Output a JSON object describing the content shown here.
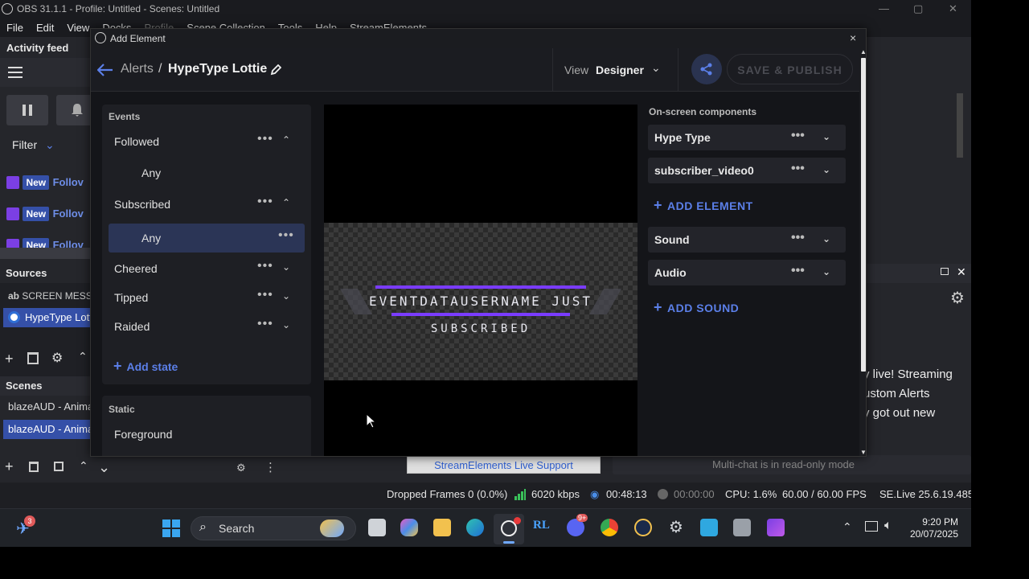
{
  "window": {
    "title": "OBS 31.1.1 - Profile: Untitled - Scenes: Untitled",
    "minimize": "—",
    "maximize": "▢",
    "close": "✕"
  },
  "menu": [
    "File",
    "Edit",
    "View",
    "Docks",
    "Profile",
    "Scene Collection",
    "Tools",
    "Help",
    "StreamElements"
  ],
  "left_dock": {
    "activity_title": "Activity feed",
    "filter_label": "Filter",
    "feed_items": [
      {
        "badge": "New",
        "text": "Follov"
      },
      {
        "badge": "New",
        "text": "Follov"
      },
      {
        "badge": "New",
        "text": "Follov"
      }
    ],
    "sources_title": "Sources",
    "sources": [
      {
        "prefix": "ab",
        "name": "SCREEN MESS"
      },
      {
        "prefix": "",
        "name": "HypeType Lott"
      }
    ],
    "scenes_title": "Scenes",
    "scenes": [
      "blazeAUD - Anima",
      "blazeAUD - Anima"
    ]
  },
  "right_dock": {
    "chat_lines": [
      "y live! Streaming",
      "ustom Alerts",
      "y got out new"
    ],
    "readonly": "Multi-chat is in read-only mode"
  },
  "bottom": {
    "support_button": "StreamElements Live Support"
  },
  "status": {
    "dropped": "Dropped Frames 0 (0.0%)",
    "bitrate": "6020 kbps",
    "live_time": "00:48:13",
    "rec_time": "00:00:00",
    "cpu": "CPU: 1.6%",
    "fps": "60.00 / 60.00 FPS",
    "se_version": "SE.Live 25.6.19.485"
  },
  "taskbar": {
    "search_placeholder": "Search",
    "notif_count": "3",
    "discord_badge": "9+",
    "time": "9:20 PM",
    "date": "20/07/2025"
  },
  "dialog": {
    "title": "Add Element",
    "close": "×",
    "breadcrumb_parent": "Alerts",
    "breadcrumb_sep": "/",
    "breadcrumb_current": "HypeType Lottie",
    "view_label": "View",
    "view_value": "Designer",
    "save_publish": "SAVE & PUBLISH",
    "events_title": "Events",
    "events": [
      {
        "label": "Followed",
        "type": "event",
        "expanded": true
      },
      {
        "label": "Any",
        "type": "state"
      },
      {
        "label": "Subscribed",
        "type": "event",
        "expanded": true
      },
      {
        "label": "Any",
        "type": "state",
        "selected": true
      },
      {
        "label": "Cheered",
        "type": "event",
        "expanded": false
      },
      {
        "label": "Tipped",
        "type": "event",
        "expanded": false
      },
      {
        "label": "Raided",
        "type": "event",
        "expanded": false
      }
    ],
    "add_state": "Add state",
    "static_title": "Static",
    "static_items": [
      "Foreground"
    ],
    "preview_line1": "EVENTDATAUSERNAME JUST",
    "preview_line2": "SUBSCRIBED",
    "components_title": "On-screen components",
    "components": [
      "Hype Type",
      "subscriber_video0"
    ],
    "add_element": "ADD ELEMENT",
    "sound_components": [
      "Sound",
      "Audio"
    ],
    "add_sound": "ADD SOUND"
  },
  "colors": {
    "accent": "#5b7fe8",
    "selected_row": "#2b3556",
    "twitch": "#7b3fe4",
    "hype_purple": "#7a3cff"
  }
}
